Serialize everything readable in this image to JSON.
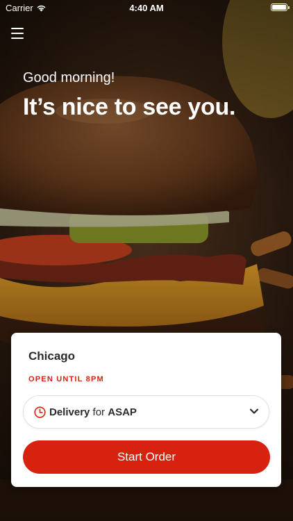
{
  "status_bar": {
    "carrier": "Carrier",
    "time": "4:40 AM",
    "battery_level": 1.0
  },
  "header": {
    "menu_icon": "hamburger-menu-icon",
    "greeting": "Good morning!",
    "headline": "It’s nice to see you."
  },
  "order_card": {
    "location_name": "Chicago",
    "hours_text": "OPEN UNTIL 8PM",
    "mode": {
      "icon": "clock-icon",
      "method": "Delivery",
      "connector": "for",
      "time": "ASAP",
      "dropdown_icon": "chevron-down-icon"
    },
    "start_button_label": "Start Order"
  },
  "colors": {
    "accent": "#d6220f",
    "card_background": "#ffffff",
    "text_dark": "#2a2a2a"
  }
}
